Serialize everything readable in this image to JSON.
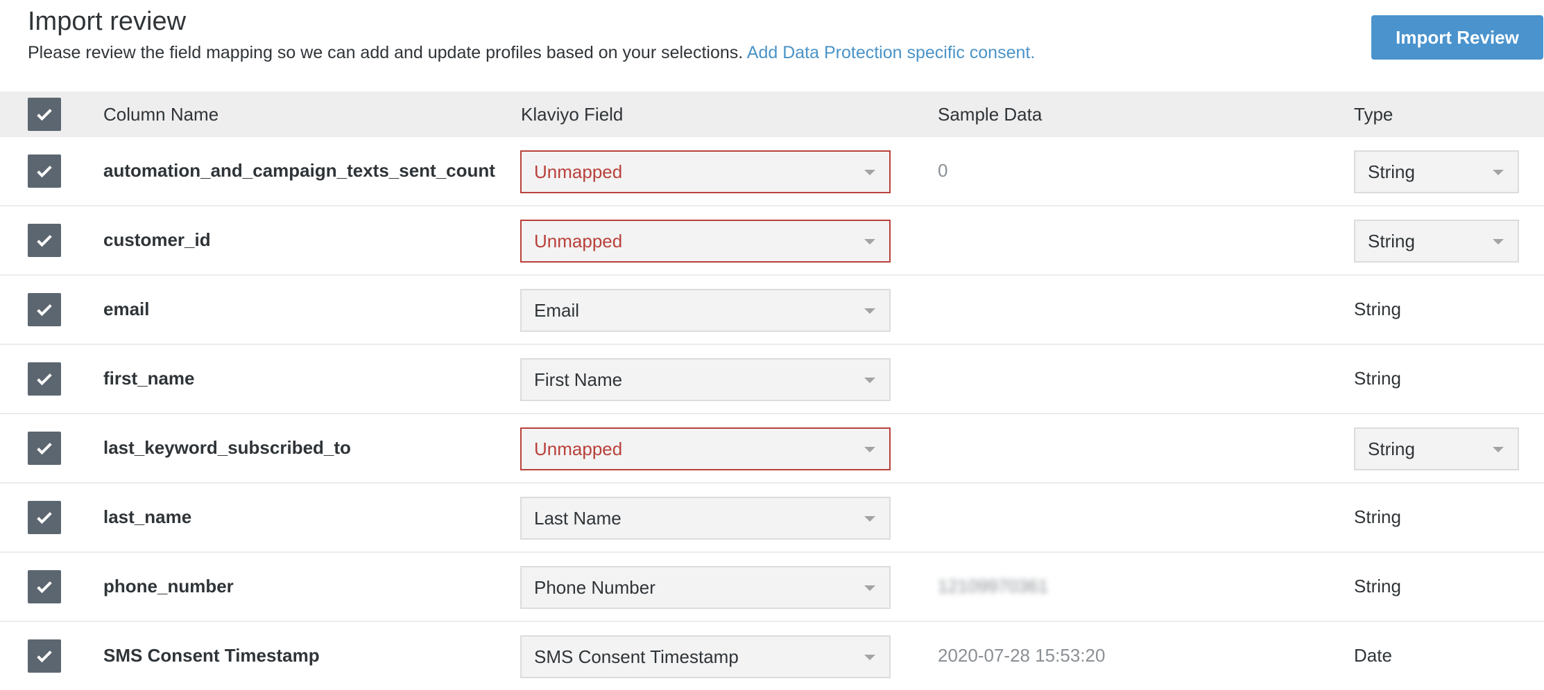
{
  "header": {
    "title": "Import review",
    "subtitle": "Please review the field mapping so we can add and update profiles based on your selections.",
    "consent_link": "Add Data Protection specific consent.",
    "import_button": "Import Review"
  },
  "table": {
    "columns": [
      "Column Name",
      "Klaviyo Field",
      "Sample Data",
      "Type"
    ],
    "all_checked": true,
    "rows": [
      {
        "name": "automation_and_campaign_texts_sent_count",
        "field": "Unmapped",
        "sample": "0",
        "type": "String",
        "unmapped": true,
        "type_select": true,
        "checked": true
      },
      {
        "name": "customer_id",
        "field": "Unmapped",
        "sample": "",
        "type": "String",
        "unmapped": true,
        "type_select": true,
        "checked": true
      },
      {
        "name": "email",
        "field": "Email",
        "sample": "",
        "type": "String",
        "unmapped": false,
        "type_select": false,
        "checked": true
      },
      {
        "name": "first_name",
        "field": "First Name",
        "sample": "",
        "type": "String",
        "unmapped": false,
        "type_select": false,
        "checked": true
      },
      {
        "name": "last_keyword_subscribed_to",
        "field": "Unmapped",
        "sample": "",
        "type": "String",
        "unmapped": true,
        "type_select": true,
        "checked": true
      },
      {
        "name": "last_name",
        "field": "Last Name",
        "sample": "",
        "type": "String",
        "unmapped": false,
        "type_select": false,
        "checked": true
      },
      {
        "name": "phone_number",
        "field": "Phone Number",
        "sample": "12109970361",
        "sample_blurred": true,
        "type": "String",
        "unmapped": false,
        "type_select": false,
        "checked": true
      },
      {
        "name": "SMS Consent Timestamp",
        "field": "SMS Consent Timestamp",
        "sample": "2020-07-28 15:53:20",
        "type": "Date",
        "unmapped": false,
        "type_select": false,
        "checked": true
      }
    ]
  },
  "colors": {
    "accent": "#4a93cd",
    "error": "#b9403a",
    "checkbox": "#5b6670"
  }
}
